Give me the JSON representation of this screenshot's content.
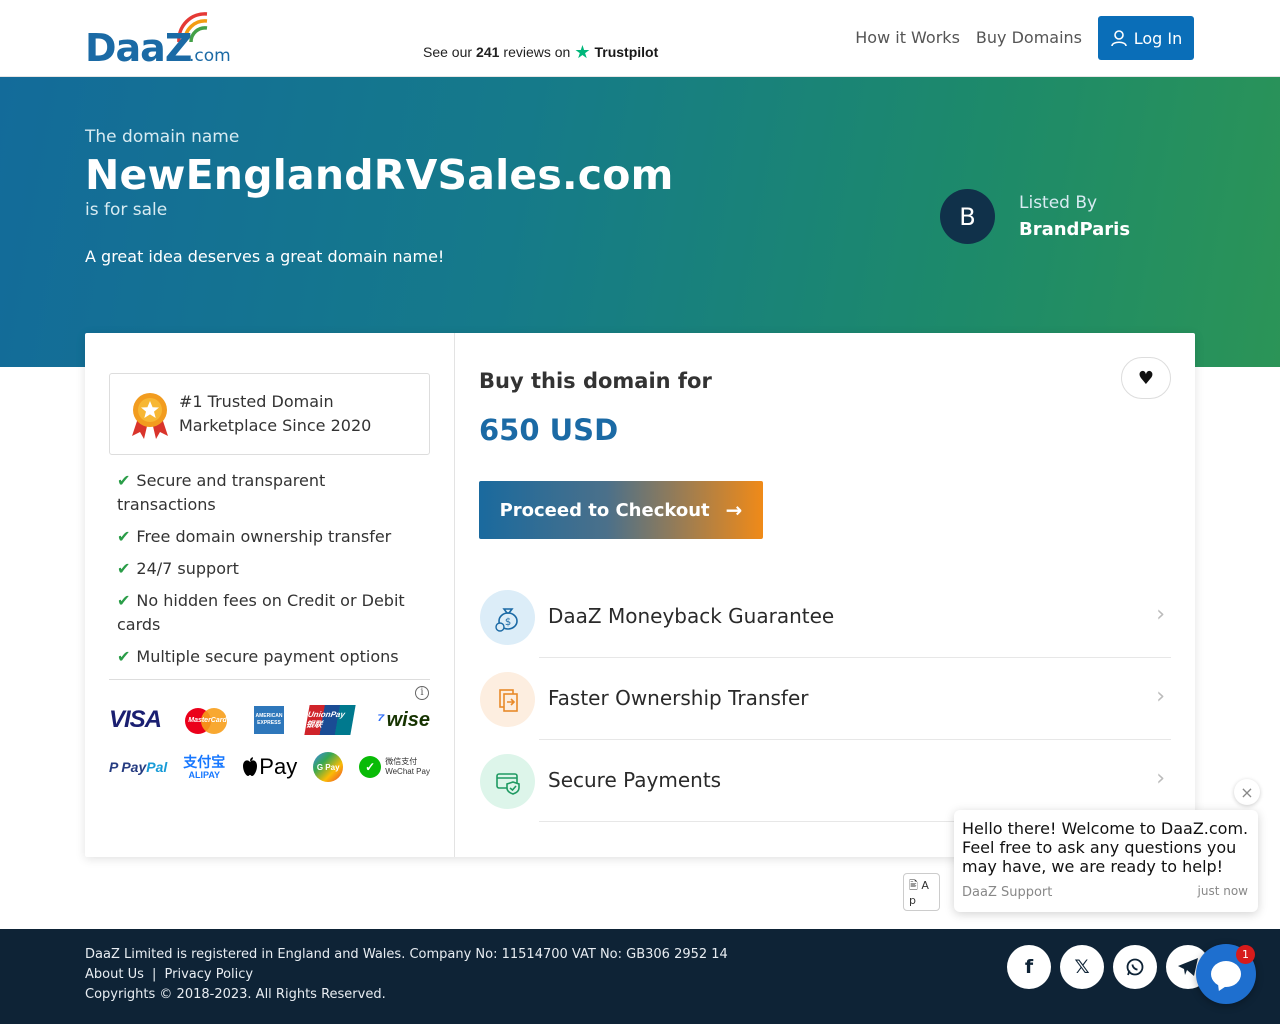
{
  "header": {
    "logo_text": "DaaZ",
    "logo_suffix": ".com",
    "trustpilot_pre": "See our",
    "trustpilot_count": "241",
    "trustpilot_post": "reviews on",
    "trustpilot_brand": "Trustpilot",
    "nav": [
      {
        "label": "How it Works"
      },
      {
        "label": "Buy Domains"
      }
    ],
    "login_label": "Log In",
    "icons": {
      "trustpilot": "star-icon",
      "login": "user-icon"
    }
  },
  "hero": {
    "kicker": "The domain name",
    "domain": "NewEnglandRVSales.com",
    "for_sale": "is for sale",
    "tagline": "A great idea deserves a great domain name!",
    "seller_initial": "B",
    "listed_label": "Listed By",
    "seller_name": "BrandParis"
  },
  "trust": {
    "badge_text": "#1 Trusted Domain Marketplace Since 2020",
    "features": [
      "Secure and transparent transactions",
      "Free domain ownership transfer",
      "24/7 support",
      "No hidden fees on Credit or Debit cards",
      "Multiple secure payment options"
    ],
    "info_glyph": "i",
    "payment_methods": {
      "visa": "VISA",
      "mastercard": "MasterCard",
      "amex": "AMERICAN EXPRESS",
      "unionpay": "UnionPay 银联",
      "wise": "wise",
      "paypal_a": "Pay",
      "paypal_b": "Pal",
      "alipay_cn": "支付宝",
      "alipay_en": "ALIPAY",
      "applepay": "Pay",
      "gpay": "G Pay",
      "wechat_cn": "微信支付",
      "wechat_en": "WeChat Pay"
    }
  },
  "purchase": {
    "buy_label": "Buy this domain for",
    "price": "650 USD",
    "checkout_label": "Proceed to Checkout",
    "benefits": [
      {
        "label": "DaaZ Moneyback Guarantee",
        "icon": "money-bag-icon"
      },
      {
        "label": "Faster Ownership Transfer",
        "icon": "transfer-document-icon"
      },
      {
        "label": "Secure Payments",
        "icon": "secure-card-icon"
      }
    ]
  },
  "chat": {
    "message": "Hello there! Welcome to DaaZ.com. Feel free to ask any questions you may have, we are ready to help!",
    "sender": "DaaZ Support",
    "time": "just now",
    "badge_count": "1",
    "image_alt": "A p"
  },
  "footer": {
    "company": "DaaZ Limited is registered in England and Wales. Company No: 11514700   VAT No: GB306 2952 14",
    "about": "About Us",
    "separator": "|",
    "privacy": "Privacy Policy",
    "copyright": "Copyrights © 2018-2023. All Rights Reserved.",
    "social_icons": [
      "facebook-icon",
      "x-icon",
      "whatsapp-icon",
      "telegram-icon"
    ]
  },
  "colors": {
    "brand_blue": "#1b6aa5",
    "button_blue": "#0a6eb8",
    "hero_start": "#136b9a",
    "hero_end": "#2b9457",
    "checkout_orange": "#f08a18",
    "check_green": "#2a9d48",
    "footer_bg": "#0e2336"
  }
}
